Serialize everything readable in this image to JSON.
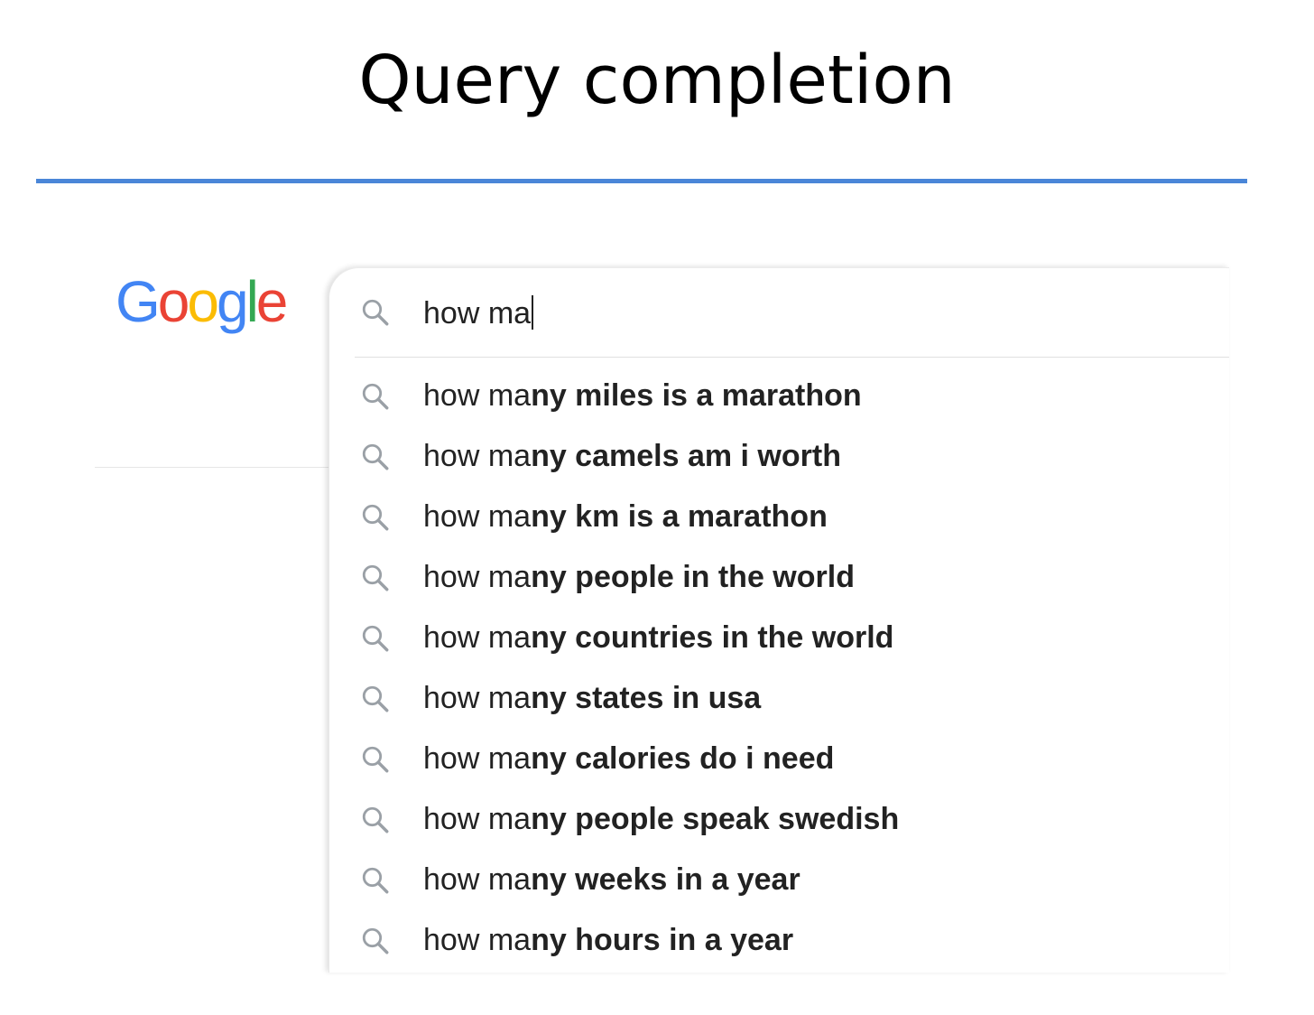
{
  "slide": {
    "title": "Query completion",
    "accent_color": "#4a86d8"
  },
  "logo": {
    "letters": [
      {
        "char": "G",
        "color": "#4285F4"
      },
      {
        "char": "o",
        "color": "#EA4335"
      },
      {
        "char": "o",
        "color": "#FBBC05"
      },
      {
        "char": "g",
        "color": "#4285F4"
      },
      {
        "char": "l",
        "color": "#34A853"
      },
      {
        "char": "e",
        "color": "#EA4335"
      }
    ]
  },
  "search": {
    "query": "how ma",
    "icon": "search-icon"
  },
  "suggestions": [
    {
      "prefix": "how ma",
      "completion": "ny miles is a marathon"
    },
    {
      "prefix": "how ma",
      "completion": "ny camels am i worth"
    },
    {
      "prefix": "how ma",
      "completion": "ny km is a marathon"
    },
    {
      "prefix": "how ma",
      "completion": "ny people in the world"
    },
    {
      "prefix": "how ma",
      "completion": "ny countries in the world"
    },
    {
      "prefix": "how ma",
      "completion": "ny states in usa"
    },
    {
      "prefix": "how ma",
      "completion": "ny calories do i need"
    },
    {
      "prefix": "how ma",
      "completion": "ny people speak swedish"
    },
    {
      "prefix": "how ma",
      "completion": "ny weeks in a year"
    },
    {
      "prefix": "how ma",
      "completion": "ny hours in a year"
    }
  ]
}
